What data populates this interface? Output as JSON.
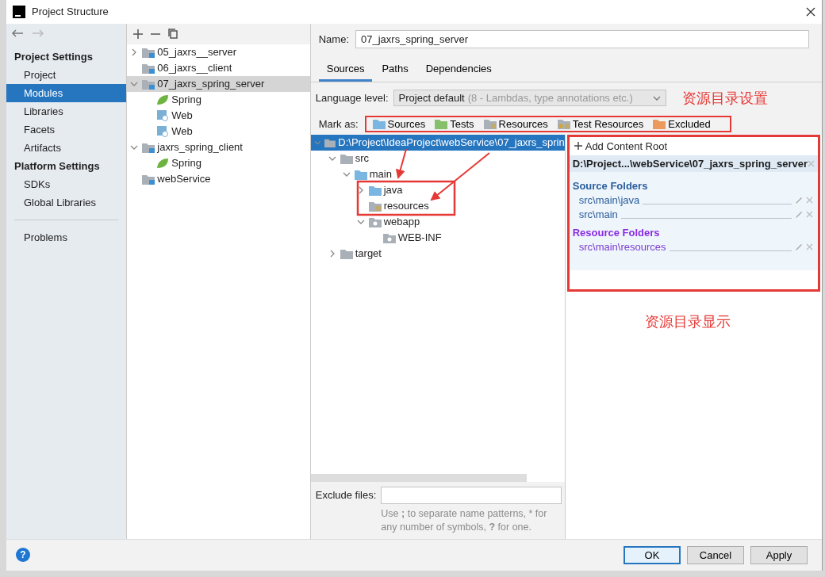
{
  "window": {
    "title": "Project Structure"
  },
  "sidebar": {
    "sections": [
      {
        "heading": "Project Settings",
        "items": [
          {
            "label": "Project",
            "selected": false
          },
          {
            "label": "Modules",
            "selected": true
          },
          {
            "label": "Libraries",
            "selected": false
          },
          {
            "label": "Facets",
            "selected": false
          },
          {
            "label": "Artifacts",
            "selected": false
          }
        ]
      },
      {
        "heading": "Platform Settings",
        "items": [
          {
            "label": "SDKs",
            "selected": false
          },
          {
            "label": "Global Libraries",
            "selected": false
          }
        ]
      },
      {
        "items": [
          {
            "label": "Problems",
            "selected": false
          }
        ]
      }
    ]
  },
  "modules": [
    {
      "label": "05_jaxrs__server",
      "kind": "module",
      "expanded": false,
      "selected": false
    },
    {
      "label": "06_jaxrs__client",
      "kind": "module",
      "selected": false
    },
    {
      "label": "07_jaxrs_spring_server",
      "kind": "module",
      "expanded": true,
      "selected": true,
      "children": [
        {
          "label": "Spring",
          "kind": "spring",
          "selected": false
        },
        {
          "label": "Web",
          "kind": "web",
          "selected": false
        },
        {
          "label": "Web",
          "kind": "web",
          "selected": false
        }
      ]
    },
    {
      "label": "jaxrs_spring_client",
      "kind": "module",
      "expanded": true,
      "selected": false,
      "children": [
        {
          "label": "Spring",
          "kind": "spring",
          "selected": false
        }
      ]
    },
    {
      "label": "webService",
      "kind": "module",
      "selected": false
    }
  ],
  "name_field": {
    "label": "Name:",
    "value": "07_jaxrs_spring_server"
  },
  "tabs": [
    {
      "label": "Sources",
      "selected": true
    },
    {
      "label": "Paths",
      "selected": false
    },
    {
      "label": "Dependencies",
      "selected": false
    }
  ],
  "language_level": {
    "label": "Language level:",
    "value": "Project default",
    "hint": "(8 - Lambdas, type annotations etc.)"
  },
  "annotations": [
    "资源目录设置",
    "资源目录显示"
  ],
  "mark_as": {
    "label": "Mark as:",
    "options": [
      {
        "label": "Sources",
        "kind": "sources"
      },
      {
        "label": "Tests",
        "kind": "tests"
      },
      {
        "label": "Resources",
        "kind": "resources"
      },
      {
        "label": "Test Resources",
        "kind": "test_resources"
      },
      {
        "label": "Excluded",
        "kind": "excluded"
      }
    ]
  },
  "content_tree": [
    {
      "label": "D:\\Project\\IdeaProject\\webService\\07_jaxrs_sprin",
      "kind": "plain",
      "expanded": true,
      "selected": true,
      "children": [
        {
          "label": "src",
          "kind": "plain",
          "expanded": true,
          "selected": false,
          "children": [
            {
              "label": "main",
              "kind": "sources",
              "expanded": true,
              "selected": false,
              "children": [
                {
                  "label": "java",
                  "kind": "sources",
                  "expanded": false,
                  "selected": false
                },
                {
                  "label": "resources",
                  "kind": "resources",
                  "selected": false
                },
                {
                  "label": "webapp",
                  "kind": "web",
                  "expanded": true,
                  "selected": false,
                  "children": [
                    {
                      "label": "WEB-INF",
                      "kind": "web",
                      "selected": false
                    }
                  ]
                }
              ]
            }
          ]
        },
        {
          "label": "target",
          "kind": "plain",
          "expanded": false,
          "selected": false
        }
      ]
    }
  ],
  "content_root": {
    "add_label": "Add Content Root",
    "path": "D:\\Project...\\webService\\07_jaxrs_spring_server",
    "groups": [
      {
        "title": "Source Folders",
        "kind": "source",
        "folders": [
          "src\\main\\java",
          "src\\main"
        ]
      },
      {
        "title": "Resource Folders",
        "kind": "resource",
        "folders": [
          "src\\main\\resources"
        ]
      }
    ]
  },
  "exclude_files": {
    "label": "Exclude files:",
    "hint": "Use **;** to separate name patterns, * for any number of symbols, **?** for one."
  },
  "help": "?",
  "buttons": [
    {
      "label": "OK",
      "default": true
    },
    {
      "label": "Cancel",
      "default": false
    },
    {
      "label": "Apply",
      "default": false
    }
  ]
}
